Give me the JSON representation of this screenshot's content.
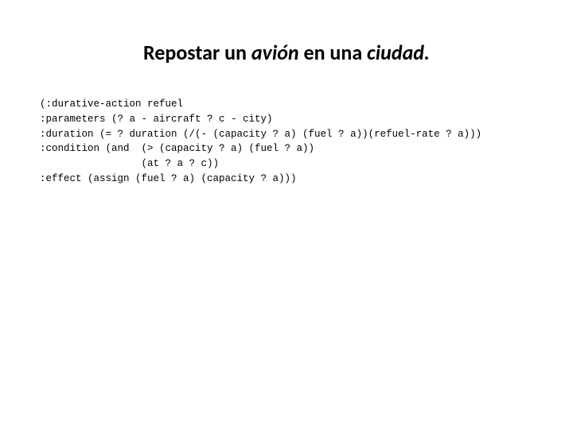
{
  "title": {
    "part1": "Repostar",
    "part2": " un ",
    "part3": "avión",
    "part4": " en una ",
    "part5": "ciudad."
  },
  "code": {
    "line1": "(:durative-action refuel",
    "line2": ":parameters (? a - aircraft ? c - city)",
    "line3": ":duration (= ? duration (/(- (capacity ? a) (fuel ? a))(refuel-rate ? a)))",
    "line4": ":condition (and  (> (capacity ? a) (fuel ? a))",
    "line5": "                 (at ? a ? c))",
    "line6": ":effect (assign (fuel ? a) (capacity ? a)))"
  }
}
